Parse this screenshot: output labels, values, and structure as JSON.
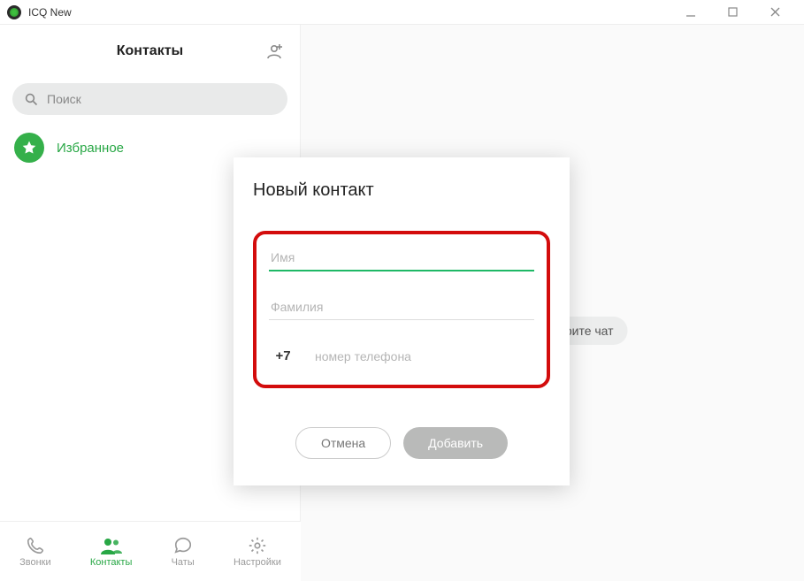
{
  "window": {
    "title": "ICQ New"
  },
  "sidebar": {
    "header_title": "Контакты",
    "search_placeholder": "Поиск",
    "favorites_label": "Избранное"
  },
  "nav": {
    "calls": "Звонки",
    "contacts": "Контакты",
    "chats": "Чаты",
    "settings": "Настройки"
  },
  "main": {
    "chip_text": "ерите чат"
  },
  "modal": {
    "title": "Новый контакт",
    "name_placeholder": "Имя",
    "surname_placeholder": "Фамилия",
    "country_code": "+7",
    "phone_placeholder": "номер телефона",
    "cancel_label": "Отмена",
    "add_label": "Добавить"
  },
  "colors": {
    "accent_green": "#28a745",
    "highlight_red": "#d30c0c",
    "disabled_gray": "#b9bab9"
  }
}
